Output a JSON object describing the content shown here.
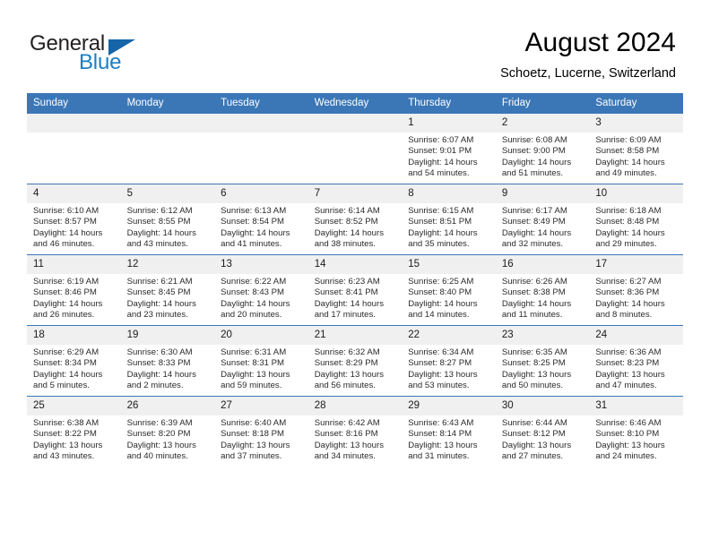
{
  "brand": {
    "name_part1": "General",
    "name_part2": "Blue",
    "triangle_icon": "triangle-logo-icon"
  },
  "header": {
    "title": "August 2024",
    "subtitle": "Schoetz, Lucerne, Switzerland"
  },
  "calendar": {
    "weekday_headers": [
      "Sunday",
      "Monday",
      "Tuesday",
      "Wednesday",
      "Thursday",
      "Friday",
      "Saturday"
    ],
    "accent_color": "#3b77b7",
    "daynum_bg": "#f0f0f0",
    "weeks": [
      [
        {
          "day": "",
          "empty": true
        },
        {
          "day": "",
          "empty": true
        },
        {
          "day": "",
          "empty": true
        },
        {
          "day": "",
          "empty": true
        },
        {
          "day": "1",
          "sunrise": "Sunrise: 6:07 AM",
          "sunset": "Sunset: 9:01 PM",
          "daylight_line1": "Daylight: 14 hours",
          "daylight_line2": "and 54 minutes."
        },
        {
          "day": "2",
          "sunrise": "Sunrise: 6:08 AM",
          "sunset": "Sunset: 9:00 PM",
          "daylight_line1": "Daylight: 14 hours",
          "daylight_line2": "and 51 minutes."
        },
        {
          "day": "3",
          "sunrise": "Sunrise: 6:09 AM",
          "sunset": "Sunset: 8:58 PM",
          "daylight_line1": "Daylight: 14 hours",
          "daylight_line2": "and 49 minutes."
        }
      ],
      [
        {
          "day": "4",
          "sunrise": "Sunrise: 6:10 AM",
          "sunset": "Sunset: 8:57 PM",
          "daylight_line1": "Daylight: 14 hours",
          "daylight_line2": "and 46 minutes."
        },
        {
          "day": "5",
          "sunrise": "Sunrise: 6:12 AM",
          "sunset": "Sunset: 8:55 PM",
          "daylight_line1": "Daylight: 14 hours",
          "daylight_line2": "and 43 minutes."
        },
        {
          "day": "6",
          "sunrise": "Sunrise: 6:13 AM",
          "sunset": "Sunset: 8:54 PM",
          "daylight_line1": "Daylight: 14 hours",
          "daylight_line2": "and 41 minutes."
        },
        {
          "day": "7",
          "sunrise": "Sunrise: 6:14 AM",
          "sunset": "Sunset: 8:52 PM",
          "daylight_line1": "Daylight: 14 hours",
          "daylight_line2": "and 38 minutes."
        },
        {
          "day": "8",
          "sunrise": "Sunrise: 6:15 AM",
          "sunset": "Sunset: 8:51 PM",
          "daylight_line1": "Daylight: 14 hours",
          "daylight_line2": "and 35 minutes."
        },
        {
          "day": "9",
          "sunrise": "Sunrise: 6:17 AM",
          "sunset": "Sunset: 8:49 PM",
          "daylight_line1": "Daylight: 14 hours",
          "daylight_line2": "and 32 minutes."
        },
        {
          "day": "10",
          "sunrise": "Sunrise: 6:18 AM",
          "sunset": "Sunset: 8:48 PM",
          "daylight_line1": "Daylight: 14 hours",
          "daylight_line2": "and 29 minutes."
        }
      ],
      [
        {
          "day": "11",
          "sunrise": "Sunrise: 6:19 AM",
          "sunset": "Sunset: 8:46 PM",
          "daylight_line1": "Daylight: 14 hours",
          "daylight_line2": "and 26 minutes."
        },
        {
          "day": "12",
          "sunrise": "Sunrise: 6:21 AM",
          "sunset": "Sunset: 8:45 PM",
          "daylight_line1": "Daylight: 14 hours",
          "daylight_line2": "and 23 minutes."
        },
        {
          "day": "13",
          "sunrise": "Sunrise: 6:22 AM",
          "sunset": "Sunset: 8:43 PM",
          "daylight_line1": "Daylight: 14 hours",
          "daylight_line2": "and 20 minutes."
        },
        {
          "day": "14",
          "sunrise": "Sunrise: 6:23 AM",
          "sunset": "Sunset: 8:41 PM",
          "daylight_line1": "Daylight: 14 hours",
          "daylight_line2": "and 17 minutes."
        },
        {
          "day": "15",
          "sunrise": "Sunrise: 6:25 AM",
          "sunset": "Sunset: 8:40 PM",
          "daylight_line1": "Daylight: 14 hours",
          "daylight_line2": "and 14 minutes."
        },
        {
          "day": "16",
          "sunrise": "Sunrise: 6:26 AM",
          "sunset": "Sunset: 8:38 PM",
          "daylight_line1": "Daylight: 14 hours",
          "daylight_line2": "and 11 minutes."
        },
        {
          "day": "17",
          "sunrise": "Sunrise: 6:27 AM",
          "sunset": "Sunset: 8:36 PM",
          "daylight_line1": "Daylight: 14 hours",
          "daylight_line2": "and 8 minutes."
        }
      ],
      [
        {
          "day": "18",
          "sunrise": "Sunrise: 6:29 AM",
          "sunset": "Sunset: 8:34 PM",
          "daylight_line1": "Daylight: 14 hours",
          "daylight_line2": "and 5 minutes."
        },
        {
          "day": "19",
          "sunrise": "Sunrise: 6:30 AM",
          "sunset": "Sunset: 8:33 PM",
          "daylight_line1": "Daylight: 14 hours",
          "daylight_line2": "and 2 minutes."
        },
        {
          "day": "20",
          "sunrise": "Sunrise: 6:31 AM",
          "sunset": "Sunset: 8:31 PM",
          "daylight_line1": "Daylight: 13 hours",
          "daylight_line2": "and 59 minutes."
        },
        {
          "day": "21",
          "sunrise": "Sunrise: 6:32 AM",
          "sunset": "Sunset: 8:29 PM",
          "daylight_line1": "Daylight: 13 hours",
          "daylight_line2": "and 56 minutes."
        },
        {
          "day": "22",
          "sunrise": "Sunrise: 6:34 AM",
          "sunset": "Sunset: 8:27 PM",
          "daylight_line1": "Daylight: 13 hours",
          "daylight_line2": "and 53 minutes."
        },
        {
          "day": "23",
          "sunrise": "Sunrise: 6:35 AM",
          "sunset": "Sunset: 8:25 PM",
          "daylight_line1": "Daylight: 13 hours",
          "daylight_line2": "and 50 minutes."
        },
        {
          "day": "24",
          "sunrise": "Sunrise: 6:36 AM",
          "sunset": "Sunset: 8:23 PM",
          "daylight_line1": "Daylight: 13 hours",
          "daylight_line2": "and 47 minutes."
        }
      ],
      [
        {
          "day": "25",
          "sunrise": "Sunrise: 6:38 AM",
          "sunset": "Sunset: 8:22 PM",
          "daylight_line1": "Daylight: 13 hours",
          "daylight_line2": "and 43 minutes."
        },
        {
          "day": "26",
          "sunrise": "Sunrise: 6:39 AM",
          "sunset": "Sunset: 8:20 PM",
          "daylight_line1": "Daylight: 13 hours",
          "daylight_line2": "and 40 minutes."
        },
        {
          "day": "27",
          "sunrise": "Sunrise: 6:40 AM",
          "sunset": "Sunset: 8:18 PM",
          "daylight_line1": "Daylight: 13 hours",
          "daylight_line2": "and 37 minutes."
        },
        {
          "day": "28",
          "sunrise": "Sunrise: 6:42 AM",
          "sunset": "Sunset: 8:16 PM",
          "daylight_line1": "Daylight: 13 hours",
          "daylight_line2": "and 34 minutes."
        },
        {
          "day": "29",
          "sunrise": "Sunrise: 6:43 AM",
          "sunset": "Sunset: 8:14 PM",
          "daylight_line1": "Daylight: 13 hours",
          "daylight_line2": "and 31 minutes."
        },
        {
          "day": "30",
          "sunrise": "Sunrise: 6:44 AM",
          "sunset": "Sunset: 8:12 PM",
          "daylight_line1": "Daylight: 13 hours",
          "daylight_line2": "and 27 minutes."
        },
        {
          "day": "31",
          "sunrise": "Sunrise: 6:46 AM",
          "sunset": "Sunset: 8:10 PM",
          "daylight_line1": "Daylight: 13 hours",
          "daylight_line2": "and 24 minutes."
        }
      ]
    ]
  }
}
